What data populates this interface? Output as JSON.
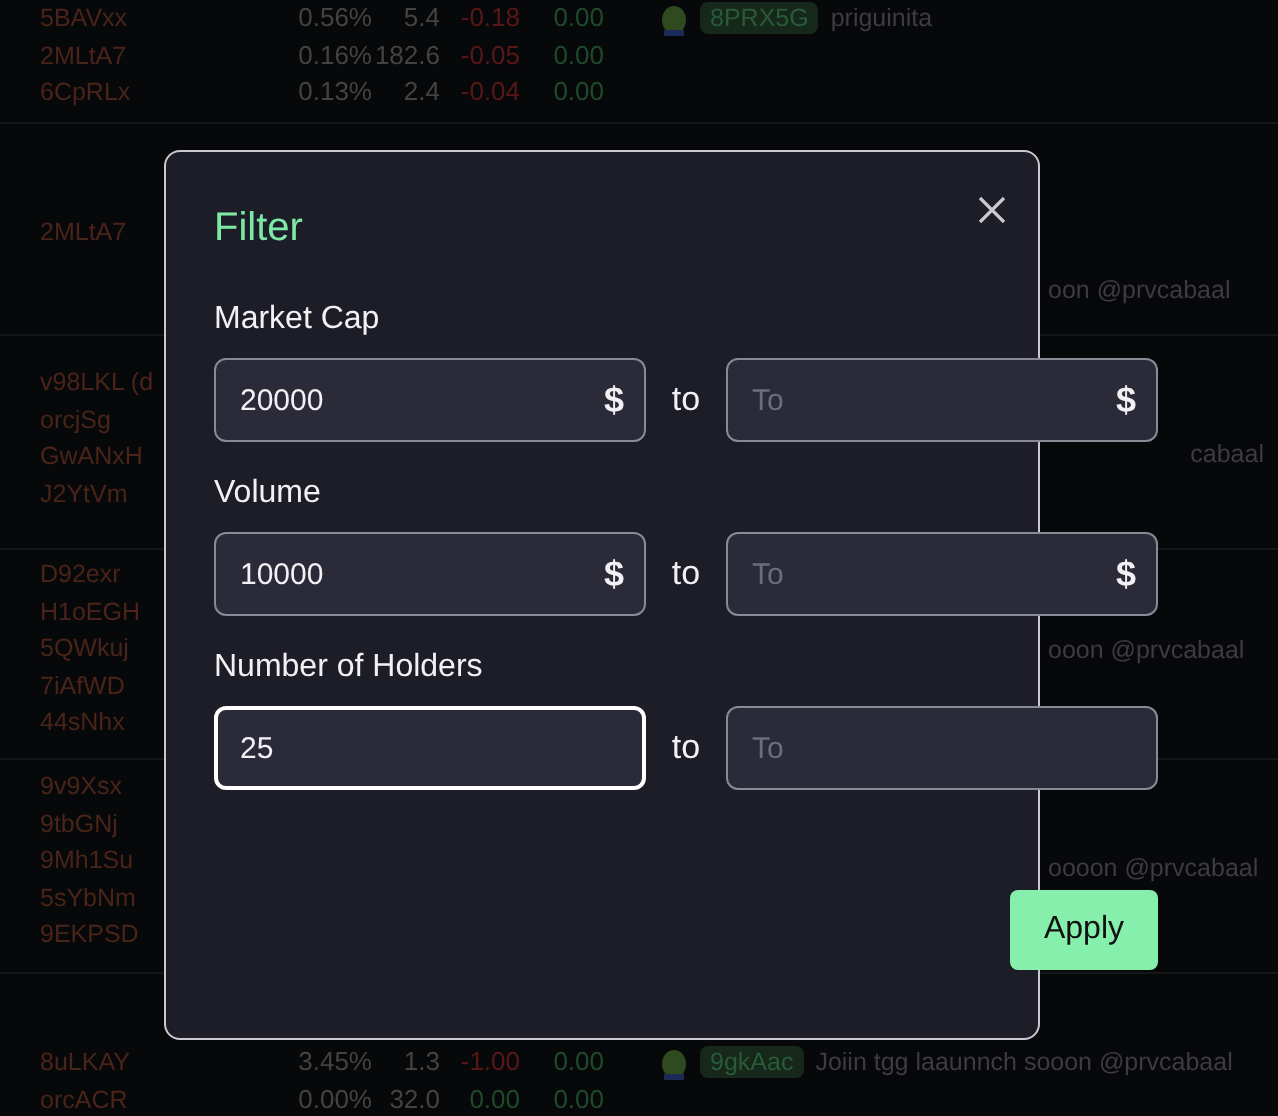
{
  "background": {
    "groups": [
      {
        "rows": [
          {
            "name": "5BAVxx",
            "change": "0.56%",
            "volume": "5.4",
            "delta": {
              "text": "-0.18",
              "color": "#5a1717"
            },
            "delta_2": "0.00"
          },
          {
            "name": "2MLtA7",
            "change": "0.16%",
            "volume": "182.6",
            "delta": {
              "text": "-0.05",
              "color": "#5a1717"
            },
            "delta_2": "0.00"
          },
          {
            "name": "6CpRLx",
            "change": "0.13%",
            "volume": "2.4",
            "delta": {
              "text": "-0.04",
              "color": "#5a1717"
            },
            "delta_2": "0.00"
          }
        ],
        "message": {
          "kind": "full",
          "badge": "8PRX5G",
          "text": "priguinita"
        }
      },
      {
        "rows": [
          {
            "name": "2MLtA7"
          }
        ],
        "message": {
          "kind": "fragment",
          "text": "oon @prvcabaal"
        }
      },
      {
        "rows": [
          {
            "name": "v98LKL (d"
          },
          {
            "name": "orcjSg"
          },
          {
            "name": "GwANxH"
          },
          {
            "name": "J2YtVm"
          }
        ],
        "message": {
          "kind": "fragment",
          "text": "cabaal"
        }
      },
      {
        "rows": [
          {
            "name": "D92exr"
          },
          {
            "name": "H1oEGH"
          },
          {
            "name": "5QWkuj"
          },
          {
            "name": "7iAfWD"
          },
          {
            "name": "44sNhx"
          }
        ],
        "message": {
          "kind": "fragment",
          "text": "ooon @prvcabaal"
        }
      },
      {
        "rows": [
          {
            "name": "9v9Xsx"
          },
          {
            "name": "9tbGNj"
          },
          {
            "name": "9Mh1Su"
          },
          {
            "name": "5sYbNm"
          },
          {
            "name": "9EKPSD"
          }
        ],
        "message": {
          "kind": "fragment",
          "text": "oooon @prvcabaal"
        }
      },
      {
        "rows": [
          {
            "name": "8uLKAY",
            "change": "3.45%",
            "volume": "1.3",
            "delta": {
              "text": "-1.00",
              "color": "#5a1717"
            },
            "delta_2": "0.00"
          },
          {
            "name": "orcACR",
            "change": "0.00%",
            "volume": "32.0",
            "delta": {
              "text": "0.00",
              "color": "#1f4a2a"
            },
            "delta_2": "0.00"
          }
        ],
        "message": {
          "kind": "full",
          "badge": "9gkAac",
          "text": "Joiin tgg laaunnch sooon @prvcabaal"
        }
      }
    ]
  },
  "dialog": {
    "title": "Filter",
    "filters": [
      {
        "label": "Market Cap",
        "min": {
          "value": "20000",
          "suffix": "$",
          "focused": false
        },
        "separator": "to",
        "max": {
          "placeholder": "To",
          "suffix": "$"
        }
      },
      {
        "label": "Volume",
        "min": {
          "value": "10000",
          "suffix": "$",
          "focused": false
        },
        "separator": "to",
        "max": {
          "placeholder": "To",
          "suffix": "$"
        }
      },
      {
        "label": "Number of Holders",
        "min": {
          "value": "25",
          "focused": true
        },
        "separator": "to",
        "max": {
          "placeholder": "To"
        }
      }
    ],
    "apply_button": "Apply"
  }
}
